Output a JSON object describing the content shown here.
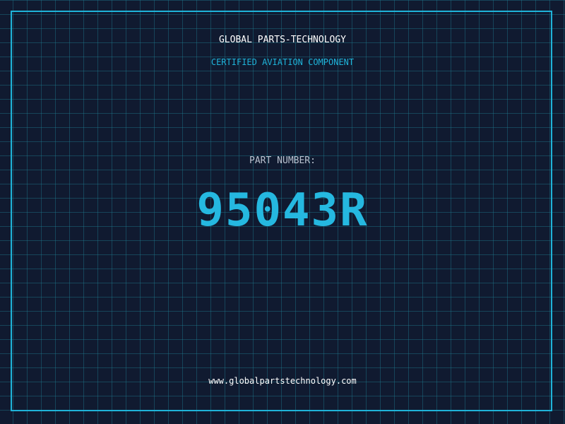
{
  "header": {
    "company": "GLOBAL PARTS-TECHNOLOGY",
    "tagline": "CERTIFIED AVIATION COMPONENT"
  },
  "part": {
    "label": "PART NUMBER:",
    "number": "95043R"
  },
  "footer": {
    "url": "www.globalpartstechnology.com"
  },
  "colors": {
    "background": "#101a30",
    "grid": "#1e788c",
    "accent": "#1fb3d9",
    "text": "#ffffff"
  }
}
